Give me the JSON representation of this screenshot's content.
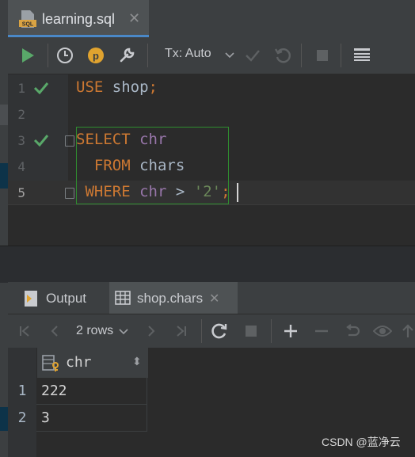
{
  "editor_tab": {
    "filename": "learning.sql",
    "icon": "sql-file-icon",
    "icon_text": "SQL",
    "close": "✕"
  },
  "toolbar": {
    "tx_mode": "Tx: Auto"
  },
  "code_lines": [
    {
      "num": "1",
      "tokens": [
        {
          "t": "USE",
          "c": "kw"
        },
        {
          "t": " shop",
          "c": "plain"
        },
        {
          "t": ";",
          "c": "kw"
        }
      ]
    },
    {
      "num": "2",
      "tokens": []
    },
    {
      "num": "3",
      "tokens": [
        {
          "t": "SELECT",
          "c": "kw"
        },
        {
          "t": " ",
          "c": "plain"
        },
        {
          "t": "chr",
          "c": "col"
        }
      ]
    },
    {
      "num": "4",
      "tokens": [
        {
          "t": "  FROM",
          "c": "kw"
        },
        {
          "t": " chars",
          "c": "plain"
        }
      ]
    },
    {
      "num": "5",
      "tokens": [
        {
          "t": " WHERE",
          "c": "kw"
        },
        {
          "t": " ",
          "c": "plain"
        },
        {
          "t": "chr",
          "c": "col"
        },
        {
          "t": " > ",
          "c": "plain"
        },
        {
          "t": "'2'",
          "c": "str"
        },
        {
          "t": ";",
          "c": "kw"
        }
      ]
    }
  ],
  "results_tabs": {
    "output": "Output",
    "table": "shop.chars",
    "close": "✕"
  },
  "results_toolbar": {
    "rows": "2 rows"
  },
  "grid": {
    "column": "chr",
    "sort_glyph": "⬍",
    "rows": [
      {
        "n": "1",
        "v": "222"
      },
      {
        "n": "2",
        "v": "3"
      }
    ]
  },
  "watermark": "CSDN @蓝净云",
  "colors": {
    "keyword": "#cc7832",
    "column": "#9876aa",
    "string": "#6a8759",
    "run_green": "#59a869",
    "accent": "#4a88c7"
  }
}
